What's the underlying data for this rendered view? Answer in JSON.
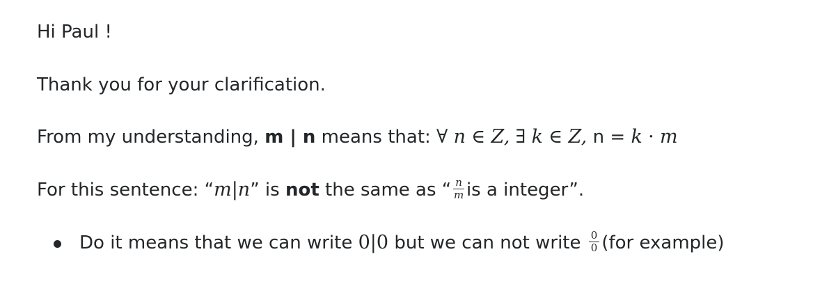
{
  "greeting": "Hi Paul !",
  "thanks": "Thank you for your clarification.",
  "definition": {
    "intro": "From my understanding, ",
    "bold": "m | n",
    "after": " means that: ",
    "forall": "∀",
    "n": "n",
    "in1": "∈",
    "Z1": "Z,",
    "exists": "∃",
    "k": "k",
    "in2": "∈",
    "Z2": "Z,",
    "eq": " n = ",
    "k2": "k",
    "dot": "·",
    "m": "m"
  },
  "sentence": {
    "intro": "For this sentence: “",
    "m": "m",
    "bar": "|",
    "n": "n",
    "close1": "” is ",
    "not": "not",
    "mid": " the same as “",
    "frac_num": "n",
    "frac_den": "m",
    "tail": "is a integer”."
  },
  "bullet": {
    "start": "Do it means that we can write ",
    "expr": "0|0",
    "mid": " but we can not write ",
    "frac_num": "0",
    "frac_den": "0",
    "tail": "(for example)"
  }
}
